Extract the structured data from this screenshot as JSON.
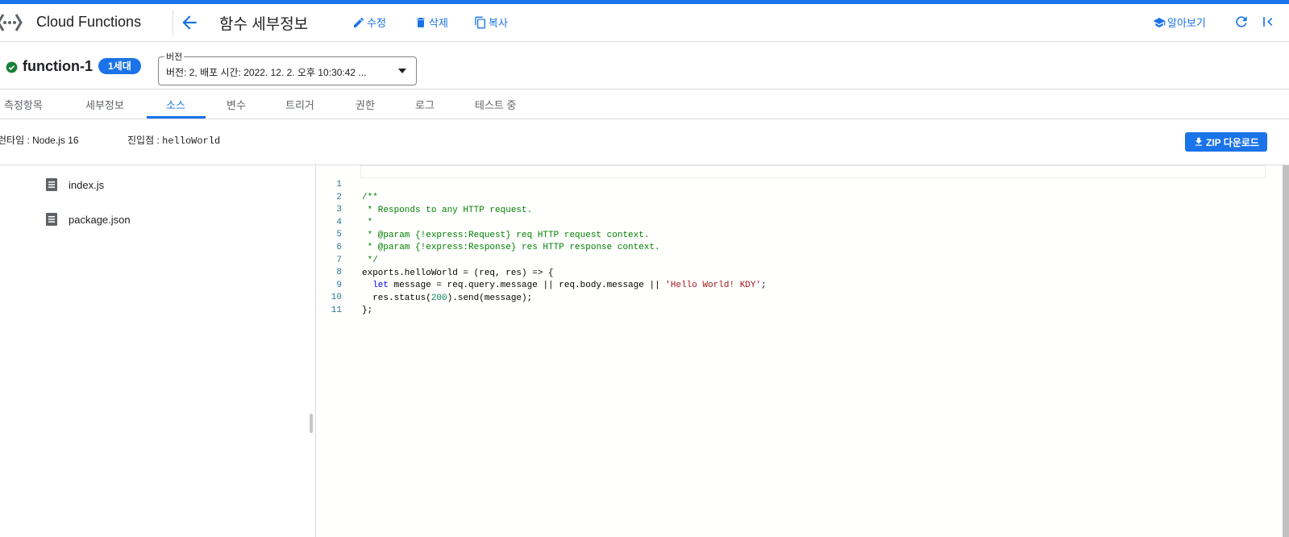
{
  "header": {
    "product_name": "Cloud Functions",
    "page_title": "함수 세부정보",
    "actions": {
      "edit": "수정",
      "delete": "삭제",
      "copy": "복사"
    },
    "learn": "알아보기"
  },
  "function": {
    "name": "function-1",
    "status_icon": "check-circle-icon",
    "generation": "1세대",
    "version_label": "버전",
    "version_value": "버전: 2, 배포 시간: 2022. 12. 2. 오후 10:30:42 ..."
  },
  "tabs": [
    "측정항목",
    "세부정보",
    "소스",
    "변수",
    "트리거",
    "권한",
    "로그",
    "테스트 중"
  ],
  "active_tab": "소스",
  "source_info": {
    "runtime_label": "런타임 :",
    "runtime_value": "Node.js 16",
    "entry_label": "진입점 :",
    "entry_value": "helloWorld",
    "zip_button": "ZIP 다운로드"
  },
  "files": [
    "index.js",
    "package.json"
  ],
  "code": {
    "line_numbers": [
      "1",
      "2",
      "3",
      "4",
      "5",
      "6",
      "7",
      "8",
      "9",
      "10",
      "11"
    ],
    "lines": [
      "/**",
      " * Responds to any HTTP request.",
      " *",
      " * @param {!express:Request} req HTTP request context.",
      " * @param {!express:Response} res HTTP response context.",
      " */",
      "exports.helloWorld = (req, res) => {",
      "  let message = req.query.message || req.body.message || 'Hello World! KDY';",
      "  res.status(200).send(message);",
      "};",
      ""
    ],
    "tokens": {
      "let_kw": "let",
      "line8_rest": " message = req.query.message || req.body.message || ",
      "line8_str": "'Hello World! KDY'",
      "line8_end": ";",
      "line9_a": "  res.status(",
      "line9_num": "200",
      "line9_b": ").send(message);"
    }
  },
  "colors": {
    "accent": "#1a73e8",
    "success": "#188038",
    "code_comment": "#008000",
    "code_keyword": "#0000ff",
    "code_string": "#a31515",
    "code_number": "#098658",
    "line_number": "#237893"
  }
}
